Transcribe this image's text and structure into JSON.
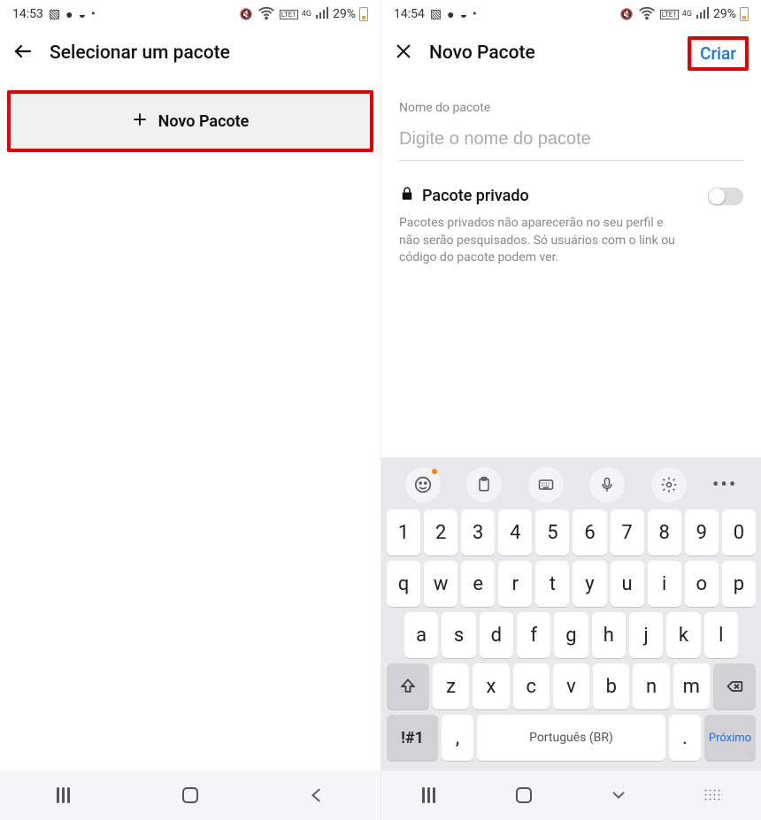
{
  "left": {
    "status": {
      "time": "14:53",
      "battery": "29%"
    },
    "header": {
      "title": "Selecionar um pacote"
    },
    "button": {
      "label": "Novo Pacote"
    }
  },
  "right": {
    "status": {
      "time": "14:54",
      "battery": "29%"
    },
    "header": {
      "title": "Novo Pacote",
      "action": "Criar"
    },
    "form": {
      "name_label": "Nome do pacote",
      "name_placeholder": "Digite o nome do pacote",
      "private_label": "Pacote privado",
      "private_desc": "Pacotes privados não aparecerão no seu perfil e não serão pesquisados. Só usuários com o link ou código do pacote podem ver."
    },
    "keyboard": {
      "row_num": [
        "1",
        "2",
        "3",
        "4",
        "5",
        "6",
        "7",
        "8",
        "9",
        "0"
      ],
      "row1": [
        "q",
        "w",
        "e",
        "r",
        "t",
        "y",
        "u",
        "i",
        "o",
        "p"
      ],
      "row2": [
        "a",
        "s",
        "d",
        "f",
        "g",
        "h",
        "j",
        "k",
        "l"
      ],
      "row3": [
        "z",
        "x",
        "c",
        "v",
        "b",
        "n",
        "m"
      ],
      "sym": "!#1",
      "space": "Português (BR)",
      "next": "Próximo",
      "comma": ",",
      "dot": "."
    }
  },
  "status_icons": {
    "lte": "LTE1",
    "net": "4G"
  }
}
